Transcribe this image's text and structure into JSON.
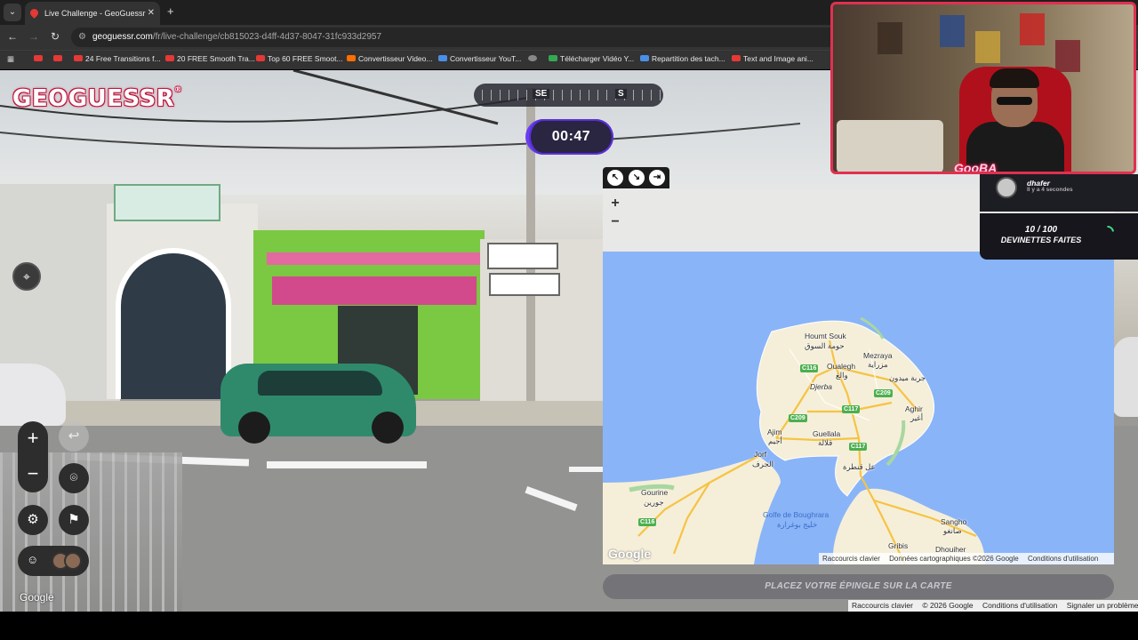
{
  "browser": {
    "tab_title": "Live Challenge - GeoGuessr",
    "tab_close": "✕",
    "new_tab": "+",
    "url_host": "geoguessr.com",
    "url_path": "/fr/live-challenge/cb815023-d4ff-4d37-8047-31fc933d2957",
    "bookmarks": [
      "24 Free Transitions f...",
      "20 FREE Smooth Tra...",
      "Top 60 FREE Smoot...",
      "Convertisseur Video...",
      "Convertisseur YouT...",
      "Télécharger Vidéo Y...",
      "Repartition des tach...",
      "Text and Image ani..."
    ]
  },
  "game": {
    "logo": "GEOGUESSR",
    "logo_reg": "®",
    "compass": {
      "left": "SE",
      "right": "S"
    },
    "timer": "00:47",
    "guess_button": "PLACEZ VOTRE ÉPINGLE SUR LA CARTE",
    "street_google": "Google"
  },
  "map": {
    "labels": {
      "houmt_souk": "Houmt Souk",
      "houmt_souk_ar": "حومة السوق",
      "mezraya": "Mezraya",
      "mezraya_ar": "مزراية",
      "oualegh": "Oualegh",
      "oualegh_ar": "والغ",
      "djerba": "Djerba",
      "midoun_ar": "جربة ميدون",
      "aghir": "Aghir",
      "aghir_ar": "أغير",
      "ajim": "Ajim",
      "ajim_ar": "أجيم",
      "guellala": "Guellala",
      "guellala_ar": "قلالة",
      "jorf": "Jorf",
      "jorf_ar": "الجرف",
      "el_kantara_ar": "عل قنطرة",
      "gourine": "Gourine",
      "gourine_ar": "جورين",
      "golfe": "Golfe de Boughrara",
      "golfe_ar": "خليج بوغرارة",
      "sangho": "Sangho",
      "sangho_ar": "صانغو",
      "gribis": "Gribis",
      "dhouiher": "Dhouiher"
    },
    "shields": [
      "C116",
      "C209",
      "C117",
      "C209",
      "C117",
      "C116"
    ],
    "google": "Google",
    "attribution": [
      "Raccourcis clavier",
      "Données cartographiques ©2026 Google",
      "Conditions d'utilisation"
    ]
  },
  "footer_attribution": [
    "Raccourcis clavier",
    "© 2026 Google",
    "Conditions d'utilisation",
    "Signaler un problème"
  ],
  "stream": {
    "badge": "GooBA",
    "sub_name": "dhafer",
    "sub_time": "Il y a 4 secondes",
    "guess_count": "10 / 100",
    "guess_label": "DEVINETTES FAITES"
  },
  "colors": {
    "map_water": "#8ab4f8",
    "map_land": "#f5efd9",
    "road_major": "#f6c343",
    "timer_accent": "#6a3cf0",
    "logo_red": "#c0123a",
    "cam_border": "#e03050"
  }
}
